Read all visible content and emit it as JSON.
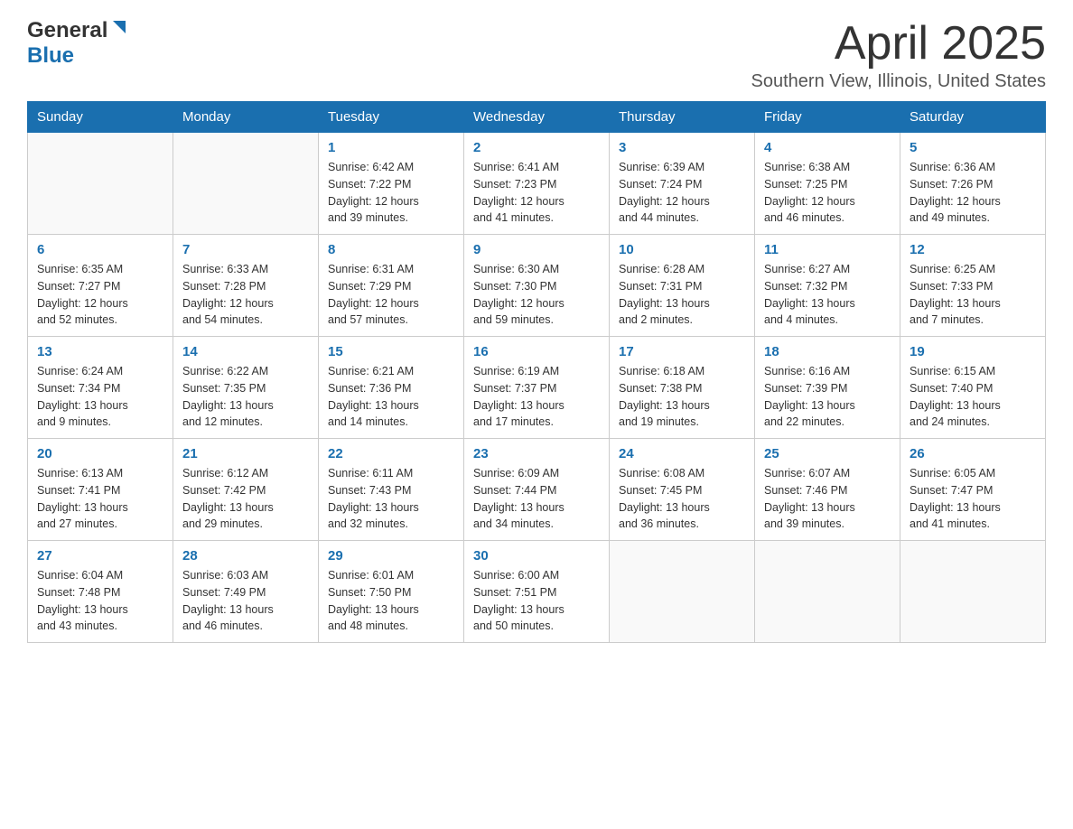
{
  "header": {
    "logo_general": "General",
    "logo_blue": "Blue",
    "month_title": "April 2025",
    "location": "Southern View, Illinois, United States"
  },
  "days_of_week": [
    "Sunday",
    "Monday",
    "Tuesday",
    "Wednesday",
    "Thursday",
    "Friday",
    "Saturday"
  ],
  "weeks": [
    [
      {
        "day": "",
        "sunrise": "",
        "sunset": "",
        "daylight": ""
      },
      {
        "day": "",
        "sunrise": "",
        "sunset": "",
        "daylight": ""
      },
      {
        "day": "1",
        "sunrise": "Sunrise: 6:42 AM",
        "sunset": "Sunset: 7:22 PM",
        "daylight": "Daylight: 12 hours and 39 minutes."
      },
      {
        "day": "2",
        "sunrise": "Sunrise: 6:41 AM",
        "sunset": "Sunset: 7:23 PM",
        "daylight": "Daylight: 12 hours and 41 minutes."
      },
      {
        "day": "3",
        "sunrise": "Sunrise: 6:39 AM",
        "sunset": "Sunset: 7:24 PM",
        "daylight": "Daylight: 12 hours and 44 minutes."
      },
      {
        "day": "4",
        "sunrise": "Sunrise: 6:38 AM",
        "sunset": "Sunset: 7:25 PM",
        "daylight": "Daylight: 12 hours and 46 minutes."
      },
      {
        "day": "5",
        "sunrise": "Sunrise: 6:36 AM",
        "sunset": "Sunset: 7:26 PM",
        "daylight": "Daylight: 12 hours and 49 minutes."
      }
    ],
    [
      {
        "day": "6",
        "sunrise": "Sunrise: 6:35 AM",
        "sunset": "Sunset: 7:27 PM",
        "daylight": "Daylight: 12 hours and 52 minutes."
      },
      {
        "day": "7",
        "sunrise": "Sunrise: 6:33 AM",
        "sunset": "Sunset: 7:28 PM",
        "daylight": "Daylight: 12 hours and 54 minutes."
      },
      {
        "day": "8",
        "sunrise": "Sunrise: 6:31 AM",
        "sunset": "Sunset: 7:29 PM",
        "daylight": "Daylight: 12 hours and 57 minutes."
      },
      {
        "day": "9",
        "sunrise": "Sunrise: 6:30 AM",
        "sunset": "Sunset: 7:30 PM",
        "daylight": "Daylight: 12 hours and 59 minutes."
      },
      {
        "day": "10",
        "sunrise": "Sunrise: 6:28 AM",
        "sunset": "Sunset: 7:31 PM",
        "daylight": "Daylight: 13 hours and 2 minutes."
      },
      {
        "day": "11",
        "sunrise": "Sunrise: 6:27 AM",
        "sunset": "Sunset: 7:32 PM",
        "daylight": "Daylight: 13 hours and 4 minutes."
      },
      {
        "day": "12",
        "sunrise": "Sunrise: 6:25 AM",
        "sunset": "Sunset: 7:33 PM",
        "daylight": "Daylight: 13 hours and 7 minutes."
      }
    ],
    [
      {
        "day": "13",
        "sunrise": "Sunrise: 6:24 AM",
        "sunset": "Sunset: 7:34 PM",
        "daylight": "Daylight: 13 hours and 9 minutes."
      },
      {
        "day": "14",
        "sunrise": "Sunrise: 6:22 AM",
        "sunset": "Sunset: 7:35 PM",
        "daylight": "Daylight: 13 hours and 12 minutes."
      },
      {
        "day": "15",
        "sunrise": "Sunrise: 6:21 AM",
        "sunset": "Sunset: 7:36 PM",
        "daylight": "Daylight: 13 hours and 14 minutes."
      },
      {
        "day": "16",
        "sunrise": "Sunrise: 6:19 AM",
        "sunset": "Sunset: 7:37 PM",
        "daylight": "Daylight: 13 hours and 17 minutes."
      },
      {
        "day": "17",
        "sunrise": "Sunrise: 6:18 AM",
        "sunset": "Sunset: 7:38 PM",
        "daylight": "Daylight: 13 hours and 19 minutes."
      },
      {
        "day": "18",
        "sunrise": "Sunrise: 6:16 AM",
        "sunset": "Sunset: 7:39 PM",
        "daylight": "Daylight: 13 hours and 22 minutes."
      },
      {
        "day": "19",
        "sunrise": "Sunrise: 6:15 AM",
        "sunset": "Sunset: 7:40 PM",
        "daylight": "Daylight: 13 hours and 24 minutes."
      }
    ],
    [
      {
        "day": "20",
        "sunrise": "Sunrise: 6:13 AM",
        "sunset": "Sunset: 7:41 PM",
        "daylight": "Daylight: 13 hours and 27 minutes."
      },
      {
        "day": "21",
        "sunrise": "Sunrise: 6:12 AM",
        "sunset": "Sunset: 7:42 PM",
        "daylight": "Daylight: 13 hours and 29 minutes."
      },
      {
        "day": "22",
        "sunrise": "Sunrise: 6:11 AM",
        "sunset": "Sunset: 7:43 PM",
        "daylight": "Daylight: 13 hours and 32 minutes."
      },
      {
        "day": "23",
        "sunrise": "Sunrise: 6:09 AM",
        "sunset": "Sunset: 7:44 PM",
        "daylight": "Daylight: 13 hours and 34 minutes."
      },
      {
        "day": "24",
        "sunrise": "Sunrise: 6:08 AM",
        "sunset": "Sunset: 7:45 PM",
        "daylight": "Daylight: 13 hours and 36 minutes."
      },
      {
        "day": "25",
        "sunrise": "Sunrise: 6:07 AM",
        "sunset": "Sunset: 7:46 PM",
        "daylight": "Daylight: 13 hours and 39 minutes."
      },
      {
        "day": "26",
        "sunrise": "Sunrise: 6:05 AM",
        "sunset": "Sunset: 7:47 PM",
        "daylight": "Daylight: 13 hours and 41 minutes."
      }
    ],
    [
      {
        "day": "27",
        "sunrise": "Sunrise: 6:04 AM",
        "sunset": "Sunset: 7:48 PM",
        "daylight": "Daylight: 13 hours and 43 minutes."
      },
      {
        "day": "28",
        "sunrise": "Sunrise: 6:03 AM",
        "sunset": "Sunset: 7:49 PM",
        "daylight": "Daylight: 13 hours and 46 minutes."
      },
      {
        "day": "29",
        "sunrise": "Sunrise: 6:01 AM",
        "sunset": "Sunset: 7:50 PM",
        "daylight": "Daylight: 13 hours and 48 minutes."
      },
      {
        "day": "30",
        "sunrise": "Sunrise: 6:00 AM",
        "sunset": "Sunset: 7:51 PM",
        "daylight": "Daylight: 13 hours and 50 minutes."
      },
      {
        "day": "",
        "sunrise": "",
        "sunset": "",
        "daylight": ""
      },
      {
        "day": "",
        "sunrise": "",
        "sunset": "",
        "daylight": ""
      },
      {
        "day": "",
        "sunrise": "",
        "sunset": "",
        "daylight": ""
      }
    ]
  ]
}
